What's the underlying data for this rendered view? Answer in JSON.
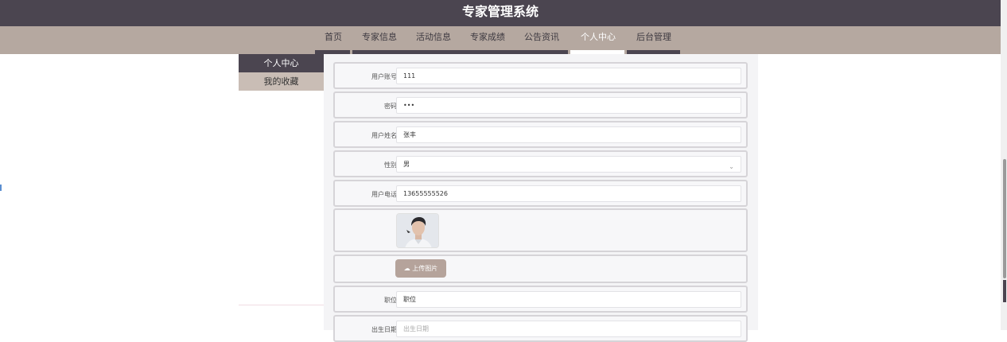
{
  "header": {
    "title": "专家管理系统"
  },
  "nav": {
    "items": [
      {
        "label": "首页"
      },
      {
        "label": "专家信息"
      },
      {
        "label": "活动信息"
      },
      {
        "label": "专家成绩"
      },
      {
        "label": "公告资讯"
      },
      {
        "label": "个人中心",
        "active": true
      },
      {
        "label": "后台管理"
      }
    ]
  },
  "sidebar": {
    "items": [
      {
        "label": "个人中心",
        "active": true
      },
      {
        "label": "我的收藏"
      }
    ]
  },
  "form": {
    "account_label": "用户账号",
    "account_value": "111",
    "password_label": "密码",
    "password_value": "•••",
    "name_label": "用户姓名",
    "name_value": "张丰",
    "gender_label": "性别",
    "gender_value": "男",
    "phone_label": "用户电话",
    "phone_value": "13655555526",
    "upload_label": "上传图片",
    "position_label": "职位",
    "position_value": "职位",
    "birthday_label": "出生日期",
    "birthday_placeholder": "出生日期"
  },
  "colors": {
    "header_bg": "#4b4550",
    "nav_bg": "#b5a8a0",
    "accent": "#b5a39b"
  }
}
